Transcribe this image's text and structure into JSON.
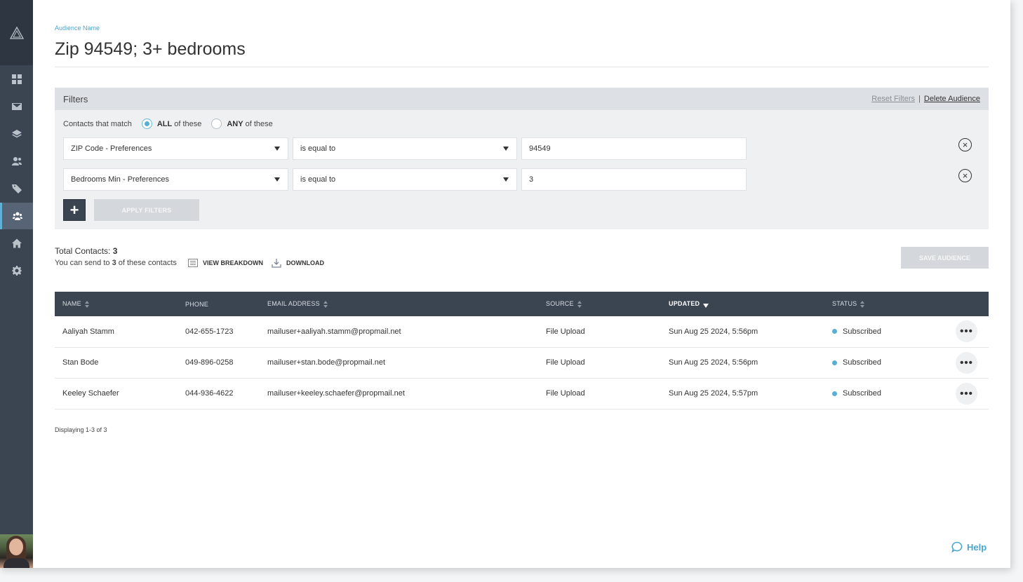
{
  "sidebar": {
    "items": [
      {
        "name": "dashboard",
        "icon": "grid-icon"
      },
      {
        "name": "mail",
        "icon": "envelope-icon"
      },
      {
        "name": "layers",
        "icon": "layers-icon"
      },
      {
        "name": "contacts",
        "icon": "contacts-icon"
      },
      {
        "name": "tags",
        "icon": "tag-icon"
      },
      {
        "name": "audiences",
        "icon": "audience-icon",
        "active": true
      },
      {
        "name": "properties",
        "icon": "home-icon"
      },
      {
        "name": "settings",
        "icon": "gear-icon"
      }
    ]
  },
  "header": {
    "label": "Audience Name",
    "title": "Zip 94549; 3+ bedrooms"
  },
  "filters": {
    "title": "Filters",
    "reset_label": "Reset Filters",
    "separator": "|",
    "delete_label": "Delete Audience",
    "match_prefix": "Contacts that match",
    "all_strong": "ALL",
    "all_rest": "of these",
    "any_strong": "ANY",
    "any_rest": "of these",
    "match_selected": "ALL",
    "rows": [
      {
        "field": "ZIP Code - Preferences",
        "operator": "is equal to",
        "value": "94549"
      },
      {
        "field": "Bedrooms Min - Preferences",
        "operator": "is equal to",
        "value": "3"
      }
    ],
    "add_label": "+",
    "apply_label": "APPLY FILTERS"
  },
  "summary": {
    "total_label": "Total Contacts:",
    "total_count": "3",
    "send_prefix": "You can send to",
    "send_count": "3",
    "send_suffix": "of these contacts",
    "view_breakdown": "VIEW BREAKDOWN",
    "download": "DOWNLOAD",
    "save_audience": "SAVE AUDIENCE"
  },
  "table": {
    "columns": [
      "NAME",
      "PHONE",
      "EMAIL ADDRESS",
      "SOURCE",
      "UPDATED",
      "STATUS"
    ],
    "rows": [
      {
        "name": "Aaliyah Stamm",
        "phone": "042-655-1723",
        "email": "mailuser+aaliyah.stamm@propmail.net",
        "source": "File Upload",
        "updated": "Sun Aug 25 2024, 5:56pm",
        "status": "Subscribed"
      },
      {
        "name": "Stan Bode",
        "phone": "049-896-0258",
        "email": "mailuser+stan.bode@propmail.net",
        "source": "File Upload",
        "updated": "Sun Aug 25 2024, 5:56pm",
        "status": "Subscribed"
      },
      {
        "name": "Keeley Schaefer",
        "phone": "044-936-4622",
        "email": "mailuser+keeley.schaefer@propmail.net",
        "source": "File Upload",
        "updated": "Sun Aug 25 2024, 5:57pm",
        "status": "Subscribed"
      }
    ],
    "more_label": "•••"
  },
  "footer": {
    "displaying": "Displaying 1-3 of 3",
    "help": "Help"
  },
  "colors": {
    "accent": "#4aa6cf",
    "sidebar": "#3b4552",
    "status_dot": "#5aaed6"
  }
}
